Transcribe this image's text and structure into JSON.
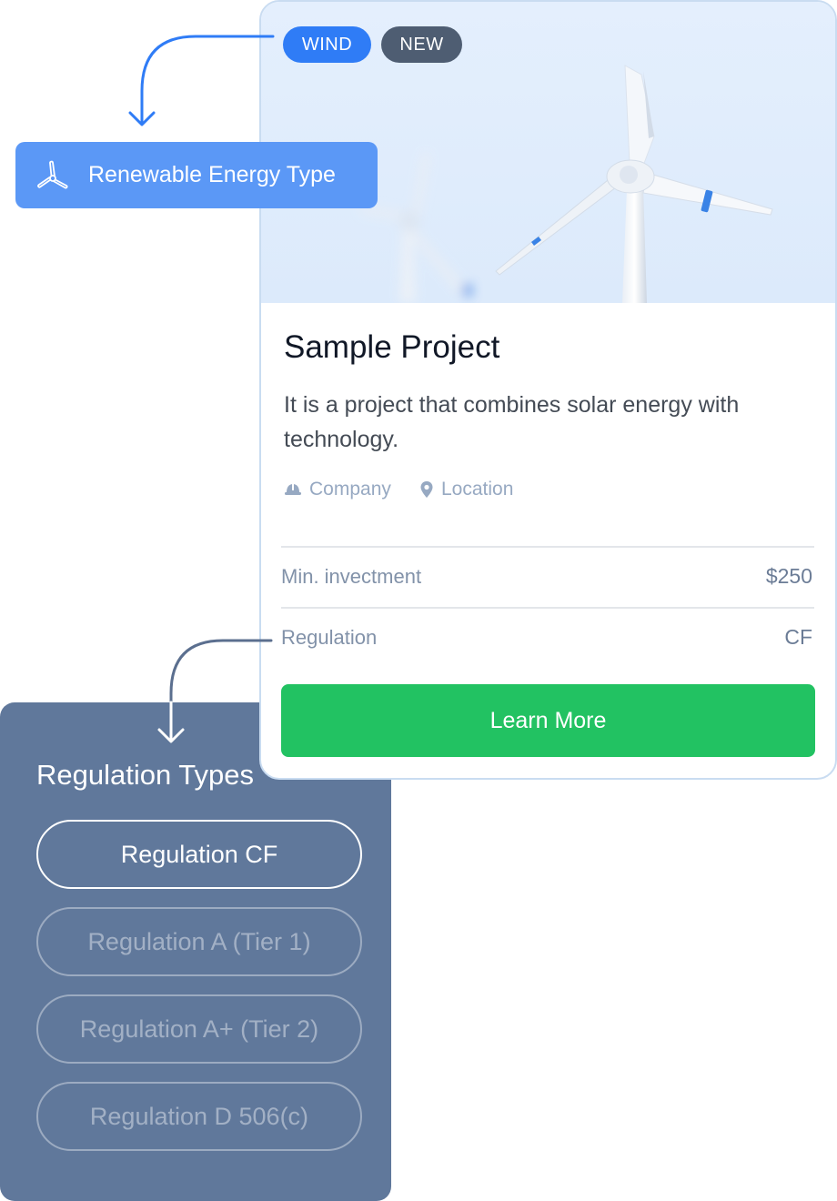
{
  "energy_chip": {
    "label": "Renewable Energy Type",
    "icon": "turbine-icon",
    "color": "#5b98f6"
  },
  "card": {
    "badges": {
      "primary": "WIND",
      "secondary": "NEW"
    },
    "title": "Sample Project",
    "description": "It is a project that combines solar energy with technology.",
    "meta": {
      "company": "Company",
      "location": "Location"
    },
    "details": [
      {
        "label": "Min. invectment",
        "value": "$250"
      },
      {
        "label": "Regulation",
        "value": "CF"
      }
    ],
    "cta_label": "Learn More",
    "colors": {
      "cta": "#22c262",
      "badge_primary": "#2f7cf6",
      "badge_secondary": "#4e5d72"
    }
  },
  "regulation_panel": {
    "title": "Regulation Types",
    "options": [
      {
        "label": "Regulation CF",
        "selected": true
      },
      {
        "label": "Regulation A (Tier 1)",
        "selected": false
      },
      {
        "label": "Regulation A+ (Tier 2)",
        "selected": false
      },
      {
        "label": "Regulation D 506(c)",
        "selected": false
      }
    ],
    "color": "#60789b"
  }
}
